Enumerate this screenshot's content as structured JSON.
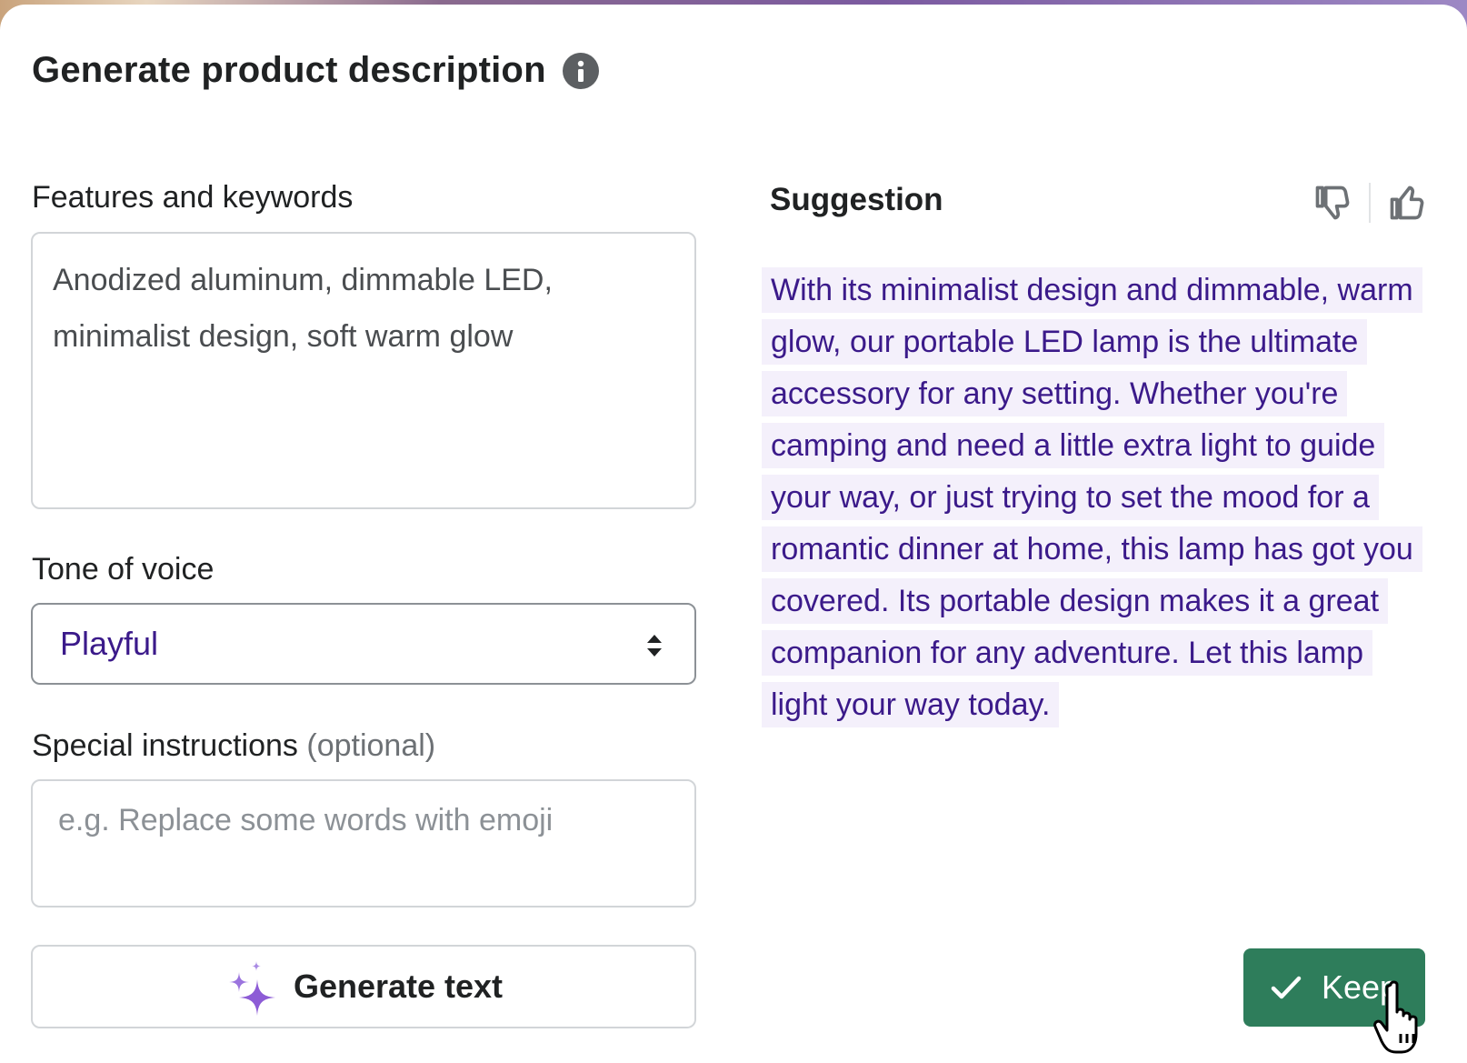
{
  "header": {
    "title": "Generate product description",
    "info_icon": "info-icon"
  },
  "form": {
    "features_label": "Features and keywords",
    "features_value": "Anodized aluminum, dimmable LED, minimalist design, soft warm glow",
    "tone_label": "Tone of voice",
    "tone_value": "Playful",
    "special_label": "Special instructions",
    "special_optional": "(optional)",
    "special_placeholder": "e.g. Replace some words with emoji",
    "generate_label": "Generate text",
    "generate_icon": "sparkles-icon"
  },
  "suggestion": {
    "label": "Suggestion",
    "text": "With its minimalist design and dimmable, warm glow, our portable LED lamp is the ultimate accessory for any setting. Whether you're camping and need a little extra light to guide your way, or just trying to set the mood for a romantic dinner at home, this lamp has got you covered. Its portable design makes it a great companion for any adventure. Let this lamp light your way today.",
    "keep_label": "Keep"
  },
  "colors": {
    "accent_purple": "#3b1a8a",
    "keep_green": "#2e7d5b",
    "highlight_bg": "#f4f0fb"
  }
}
